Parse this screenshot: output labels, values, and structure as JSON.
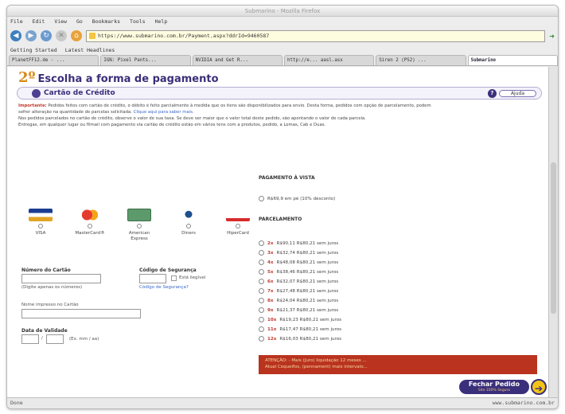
{
  "window": {
    "title": "Submarino - Mozilla Firefox"
  },
  "menu": [
    "File",
    "Edit",
    "View",
    "Go",
    "Bookmarks",
    "Tools",
    "Help"
  ],
  "address": {
    "url": "https://www.submarino.com.br/Payment.aspx?ddrId=9460587"
  },
  "bookmarks": [
    "Getting Started",
    "Latest Headlines"
  ],
  "tabs": [
    "PlanetFF12.de - ...",
    "IGN: Pixel Pants...",
    "NVIDIA and Get R...",
    "http://e... aasl.asx",
    "Siren 2 (PS2) ...",
    "Submarino"
  ],
  "page": {
    "step_number": "2º",
    "step_title": "Escolha a forma de pagamento",
    "section_title": "Cartão de Crédito",
    "help_label": "Ajuda",
    "notes": {
      "important_label": "Importante:",
      "line1": "Pedidos feitos com cartão de crédito, o débito é feito parcialmente à medida que os itens são disponibilizados para envio. Desta forma, pedidos com opção de parcelamento, podem",
      "line2": "sofrer alteração na quantidade de parcelas solicitada.",
      "line2_link": "Clique aqui para saber mais.",
      "line3": "Nos pedidos parcelados no cartão de crédito, observe o valor de sua taxa. Se deve ser maior que o valor total deste pedido, são apontando o valor de cada parcela.",
      "line4": "Entregas, em qualquer lugar ou filmail com pagamento via cartão de crédito estão em vários tens com a produtos, pedido, a Lomas, Cab e Duas."
    },
    "cards": [
      "VISA",
      "MasterCard®",
      "American Express",
      "Diners",
      "HiperCard"
    ],
    "form": {
      "card_number_label": "Número do Cartão",
      "card_number_hint": "(Digite apenas os números)",
      "security_code_label": "Código de Segurança",
      "unreadable_label": "Está ilegível",
      "security_code_link": "Código de Segurança?",
      "name_label": "Nome impresso no Cartão",
      "expiry_label": "Data de Validade",
      "expiry_hint": "(Ex. mm / aa)"
    },
    "payment": {
      "single_heading": "PAGAMENTO À VISTA",
      "single_option": "R$69,9 em pé (10% desconto)",
      "installments_heading": "PARCELAMENTO",
      "installments": [
        {
          "num": "2x",
          "text": "R$90,11 R$80,21 sem juros"
        },
        {
          "num": "3x",
          "text": "R$32,74 R$80,21 sem juros"
        },
        {
          "num": "4x",
          "text": "R$48,08 R$80,21 sem juros"
        },
        {
          "num": "5x",
          "text": "R$38,46 R$80,21 sem juros"
        },
        {
          "num": "6x",
          "text": "R$32,07 R$80,21 sem juros"
        },
        {
          "num": "7x",
          "text": "R$27,48 R$80,21 sem juros"
        },
        {
          "num": "8x",
          "text": "R$24,04 R$80,21 sem juros"
        },
        {
          "num": "9x",
          "text": "R$21,37 R$80,21 sem juros"
        },
        {
          "num": "10x",
          "text": "R$19,23 R$80,21 sem juros"
        },
        {
          "num": "11x",
          "text": "R$17,47 R$80,21 sem juros"
        },
        {
          "num": "12x",
          "text": "R$16,03 R$80,21 sem juros"
        }
      ],
      "alert_line1": "ATENÇÃO: - Mais (Juro) liquidação 12 meses ...",
      "alert_line2": "Atual Coqueifos, (pennament) mais intervalo..."
    },
    "close_button": {
      "label": "Fechar Pedido",
      "sub": "Site 100% Seguro"
    }
  },
  "status": {
    "left": "Done",
    "right": "www.submarino.com.br"
  },
  "colors": {
    "brand_purple": "#3a2f7a",
    "brand_orange": "#d98a1a",
    "alert_red": "#b9331f"
  }
}
